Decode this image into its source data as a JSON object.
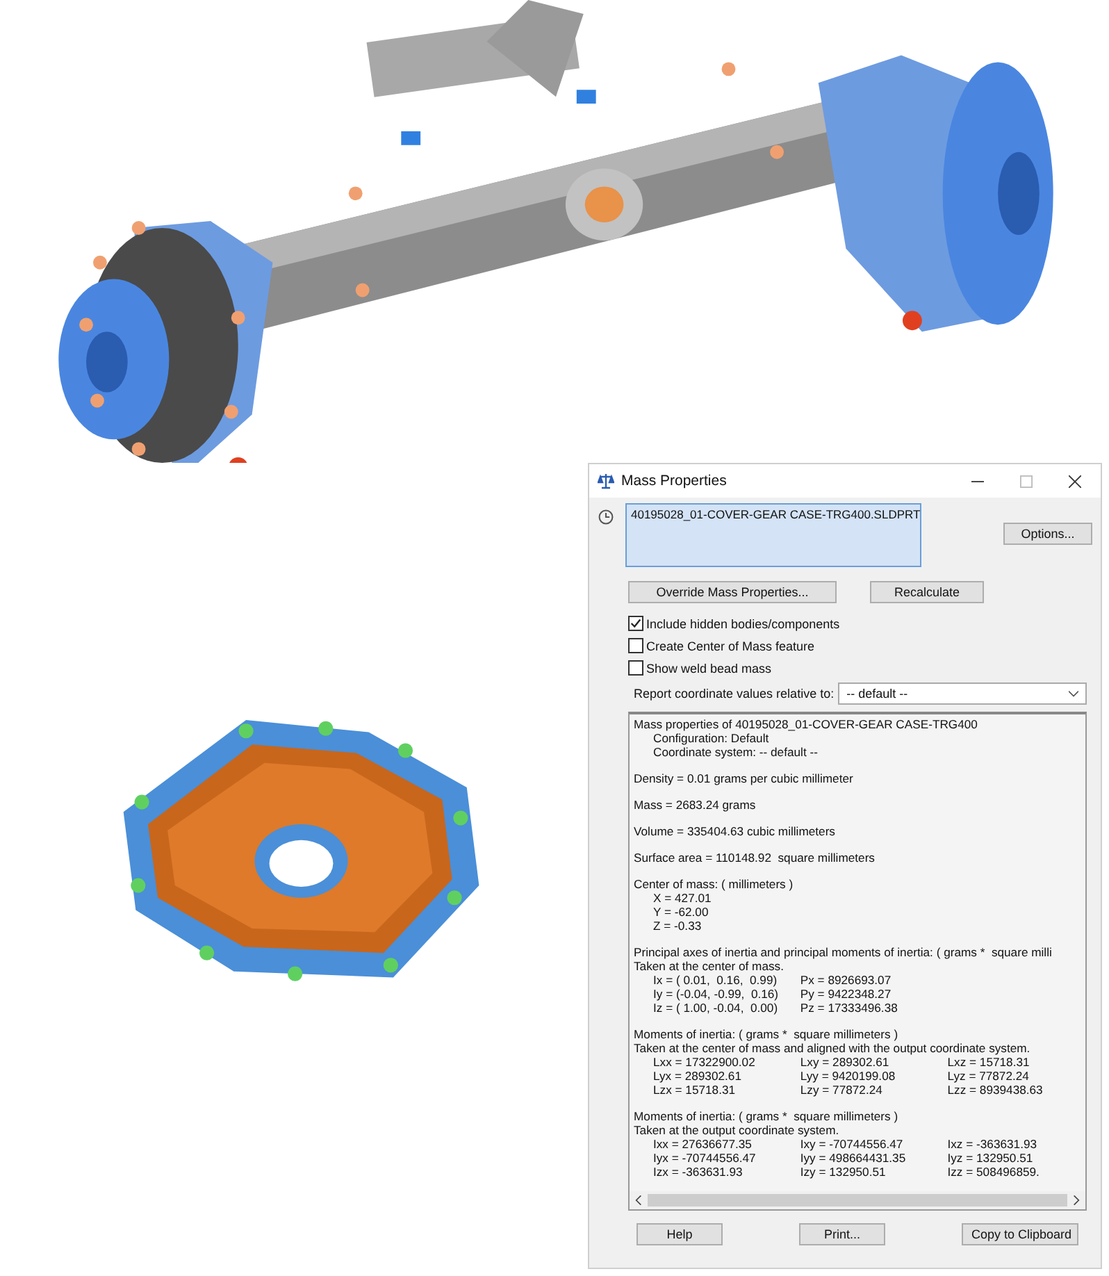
{
  "window": {
    "title": "Mass Properties"
  },
  "selection_list": {
    "items": [
      "40195028_01-COVER-GEAR CASE-TRG400.SLDPRT"
    ]
  },
  "options_button": "Options...",
  "action_buttons": [
    "Override Mass Properties...",
    "Recalculate"
  ],
  "checkboxes": [
    {
      "label": "Include hidden bodies/components",
      "checked": true
    },
    {
      "label": "Create Center of Mass feature",
      "checked": false
    },
    {
      "label": "Show weld bead mass",
      "checked": false
    }
  ],
  "coordinate_select": {
    "label": "Report coordinate values relative to:",
    "value": "-- default --"
  },
  "report": {
    "blocks": [
      [
        {
          "kind": "text",
          "text": "Mass properties of 40195028_01-COVER-GEAR CASE-TRG400",
          "indented": false
        },
        {
          "kind": "text",
          "text": "Configuration: Default",
          "indented": true
        },
        {
          "kind": "text",
          "text": "Coordinate system: -- default --",
          "indented": true
        }
      ],
      [
        {
          "kind": "text",
          "text": "Density = 0.01 grams per cubic millimeter",
          "indented": false
        }
      ],
      [
        {
          "kind": "text",
          "text": "Mass = 2683.24 grams",
          "indented": false
        }
      ],
      [
        {
          "kind": "text",
          "text": "Volume = 335404.63 cubic millimeters",
          "indented": false
        }
      ],
      [
        {
          "kind": "text",
          "text": "Surface area = 110148.92  square millimeters",
          "indented": false
        }
      ],
      [
        {
          "kind": "text",
          "text": "Center of mass: ( millimeters )",
          "indented": false
        },
        {
          "kind": "text",
          "text": "X = 427.01",
          "indented": true
        },
        {
          "kind": "text",
          "text": "Y = -62.00",
          "indented": true
        },
        {
          "kind": "text",
          "text": "Z = -0.33",
          "indented": true
        }
      ],
      [
        {
          "kind": "text",
          "text": "Principal axes of inertia and principal moments of inertia: ( grams *  square milli",
          "indented": false
        },
        {
          "kind": "text",
          "text": "Taken at the center of mass.",
          "indented": false
        },
        {
          "kind": "columns",
          "cells": [
            "Ix = ( 0.01,  0.16,  0.99)",
            "Px = 8926693.07"
          ]
        },
        {
          "kind": "columns",
          "cells": [
            "Iy = (-0.04, -0.99,  0.16)",
            "Py = 9422348.27"
          ]
        },
        {
          "kind": "columns",
          "cells": [
            "Iz = ( 1.00, -0.04,  0.00)",
            "Pz = 17333496.38"
          ]
        }
      ],
      [
        {
          "kind": "text",
          "text": "Moments of inertia: ( grams *  square millimeters )",
          "indented": false
        },
        {
          "kind": "text",
          "text": "Taken at the center of mass and aligned with the output coordinate system.",
          "indented": false
        },
        {
          "kind": "columns",
          "cells": [
            "Lxx = 17322900.02",
            "Lxy = 289302.61",
            "Lxz = 15718.31"
          ]
        },
        {
          "kind": "columns",
          "cells": [
            "Lyx = 289302.61",
            "Lyy = 9420199.08",
            "Lyz = 77872.24"
          ]
        },
        {
          "kind": "columns",
          "cells": [
            "Lzx = 15718.31",
            "Lzy = 77872.24",
            "Lzz = 8939438.63"
          ]
        }
      ],
      [
        {
          "kind": "text",
          "text": "Moments of inertia: ( grams *  square millimeters )",
          "indented": false
        },
        {
          "kind": "text",
          "text": "Taken at the output coordinate system.",
          "indented": false
        },
        {
          "kind": "columns",
          "cells": [
            "Ixx = 27636677.35",
            "Ixy = -70744556.47",
            "Ixz = -363631.93"
          ]
        },
        {
          "kind": "columns",
          "cells": [
            "Iyx = -70744556.47",
            "Iyy = 498664431.35",
            "Iyz = 132950.51"
          ]
        },
        {
          "kind": "columns",
          "cells": [
            "Izx = -363631.93",
            "Izy = 132950.51",
            "Izz = 508496859."
          ]
        }
      ]
    ]
  },
  "footer_buttons": [
    "Help",
    "Print...",
    "Copy to Clipboard"
  ]
}
